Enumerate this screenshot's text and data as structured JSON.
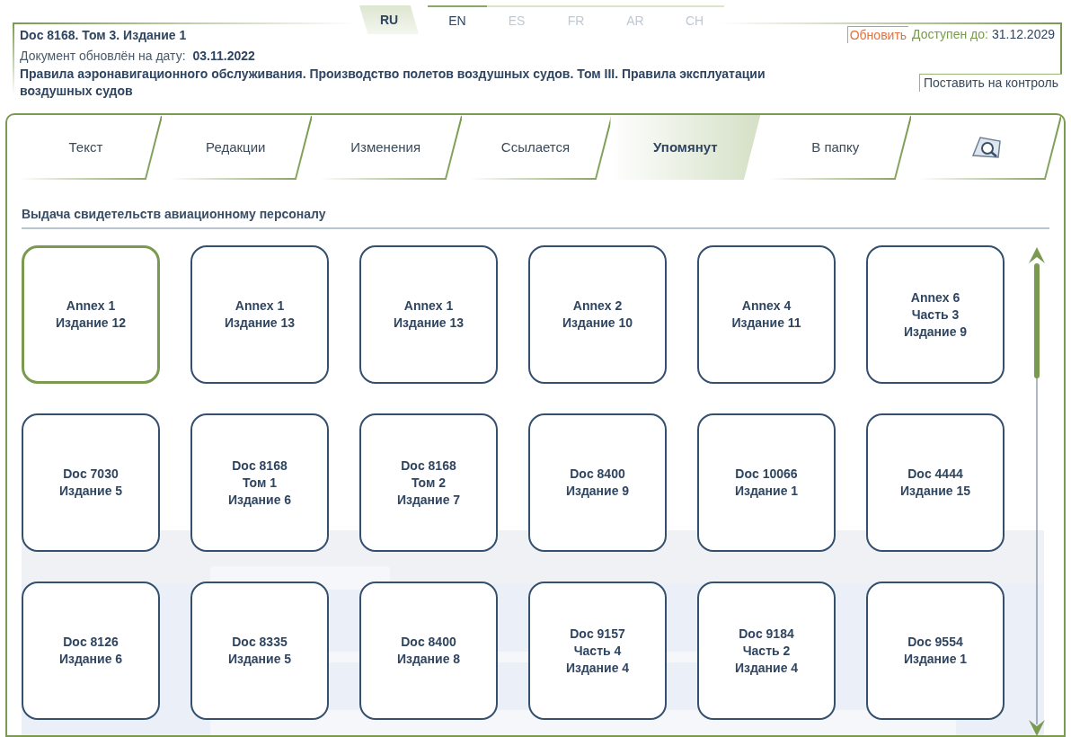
{
  "languages": [
    {
      "label": "RU",
      "selected": true,
      "disabled": false
    },
    {
      "label": "EN",
      "selected": false,
      "disabled": false
    },
    {
      "label": "ES",
      "selected": false,
      "disabled": true
    },
    {
      "label": "FR",
      "selected": false,
      "disabled": true
    },
    {
      "label": "AR",
      "selected": false,
      "disabled": true
    },
    {
      "label": "CH",
      "selected": false,
      "disabled": true
    }
  ],
  "document": {
    "code": "Doc 8168. Том 3. Издание 1",
    "updated_label": "Документ обновлён на дату:",
    "updated_date": "03.11.2022",
    "title": "Правила аэронавигационного обслуживания. Производство полетов воздушных судов. Том III. Правила эксплуатации воздушных судов"
  },
  "refresh_link": "Обновить",
  "available_label": "Доступен до:",
  "available_date": "31.12.2029",
  "watch_button": "Поставить на контроль",
  "tabs": [
    {
      "kind": "text",
      "label": "Текст",
      "selected": false
    },
    {
      "kind": "text",
      "label": "Редакции",
      "selected": false
    },
    {
      "kind": "text",
      "label": "Изменения",
      "selected": false
    },
    {
      "kind": "text",
      "label": "Ссылается",
      "selected": false
    },
    {
      "kind": "text",
      "label": "Упомянут",
      "selected": true
    },
    {
      "kind": "text",
      "label": "В папку",
      "selected": false
    },
    {
      "kind": "search",
      "selected": false
    }
  ],
  "section_title": "Выдача свидетельств авиационному персоналу",
  "cards": [
    {
      "lines": [
        "Annex 1",
        "Издание 12"
      ],
      "selected": true
    },
    {
      "lines": [
        "Annex 1",
        "Издание 13"
      ],
      "selected": false
    },
    {
      "lines": [
        "Annex 1",
        "Издание 13"
      ],
      "selected": false
    },
    {
      "lines": [
        "Annex 2",
        "Издание 10"
      ],
      "selected": false
    },
    {
      "lines": [
        "Annex 4",
        "Издание 11"
      ],
      "selected": false
    },
    {
      "lines": [
        "Annex 6",
        "Часть 3",
        "Издание 9"
      ],
      "selected": false
    },
    {
      "lines": [
        "Doc 7030",
        "Издание 5"
      ],
      "selected": false
    },
    {
      "lines": [
        "Doc 8168",
        "Том 1",
        "Издание 6"
      ],
      "selected": false
    },
    {
      "lines": [
        "Doc 8168",
        "Том 2",
        "Издание 7"
      ],
      "selected": false
    },
    {
      "lines": [
        "Doc 8400",
        "Издание 9"
      ],
      "selected": false
    },
    {
      "lines": [
        "Doc 10066",
        "Издание 1"
      ],
      "selected": false
    },
    {
      "lines": [
        "Doc 4444",
        "Издание 15"
      ],
      "selected": false
    },
    {
      "lines": [
        "Doc 8126",
        "Издание 6"
      ],
      "selected": false
    },
    {
      "lines": [
        "Doc 8335",
        "Издание 5"
      ],
      "selected": false
    },
    {
      "lines": [
        "Doc 8400",
        "Издание 8"
      ],
      "selected": false
    },
    {
      "lines": [
        "Doc 9157",
        "Часть 4",
        "Издание 4"
      ],
      "selected": false
    },
    {
      "lines": [
        "Doc 9184",
        "Часть 2",
        "Издание 4"
      ],
      "selected": false
    },
    {
      "lines": [
        "Doc 9554",
        "Издание 1"
      ],
      "selected": false
    }
  ]
}
